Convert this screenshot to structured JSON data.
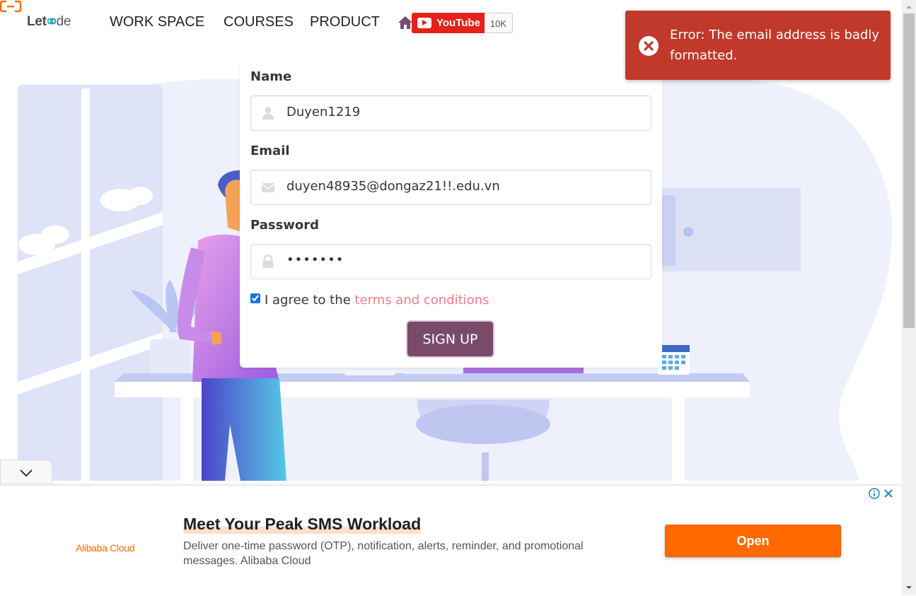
{
  "header": {
    "brand_left": "Let",
    "brand_right": "de",
    "nav": [
      "WORK SPACE",
      "COURSES",
      "PRODUCT"
    ],
    "youtube_label": "YouTube",
    "youtube_count": "10K"
  },
  "toast": {
    "message": "Error: The email address is badly formatted.",
    "color": "#c0392b"
  },
  "form": {
    "name_label": "Name",
    "name_value": "Duyen1219",
    "email_label": "Email",
    "email_value": "duyen48935@dongaz21!!.edu.vn",
    "password_label": "Password",
    "password_value": "•••••••",
    "agree_text": "I agree to the",
    "terms_link": "terms and conditions",
    "agree_checked": true,
    "signup_label": "SIGN UP",
    "signup_color": "#7a4a6b"
  },
  "ad": {
    "brand": "Alibaba Cloud",
    "title": "Meet Your Peak SMS Workload",
    "description": "Deliver one-time password (OTP), notification, alerts, reminder, and promotional messages. Alibaba Cloud",
    "cta": "Open",
    "cta_color": "#ff6a00"
  }
}
